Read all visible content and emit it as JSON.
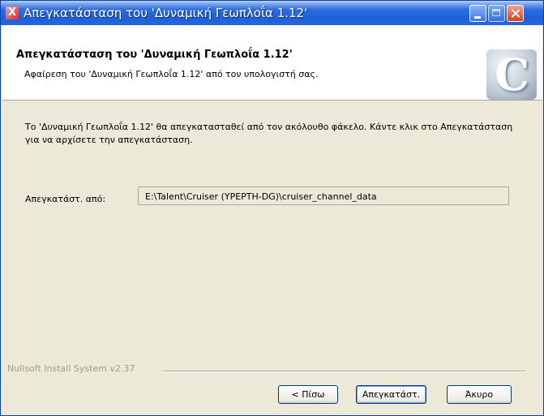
{
  "window": {
    "title": "Απεγκατάσταση του 'Δυναμική Γεωπλοΐα 1.12'",
    "icon": "X"
  },
  "header": {
    "title": "Απεγκατάσταση του 'Δυναμική Γεωπλοΐα 1.12'",
    "subtitle": "Αφαίρεση του 'Δυναμική Γεωπλοΐα 1.12' από τον υπολογιστή σας.",
    "logo_letter": "C"
  },
  "main": {
    "description": "Το 'Δυναμική Γεωπλοΐα 1.12' θα απεγκατασταθεί από τον ακόλουθο φάκελο. Κάντε κλικ στο Απεγκατάσταση για να αρχίσετε την απεγκατάσταση.",
    "folder_label": "Απεγκατάστ. από:",
    "folder_value": "E:\\Talent\\Cruiser (YPEPTH-DG)\\cruiser_channel_data"
  },
  "branding": "Nullsoft Install System v2.37",
  "buttons": {
    "back": "< Πίσω",
    "uninstall": "Απεγκατάστ.",
    "cancel": "Άκυρο"
  }
}
